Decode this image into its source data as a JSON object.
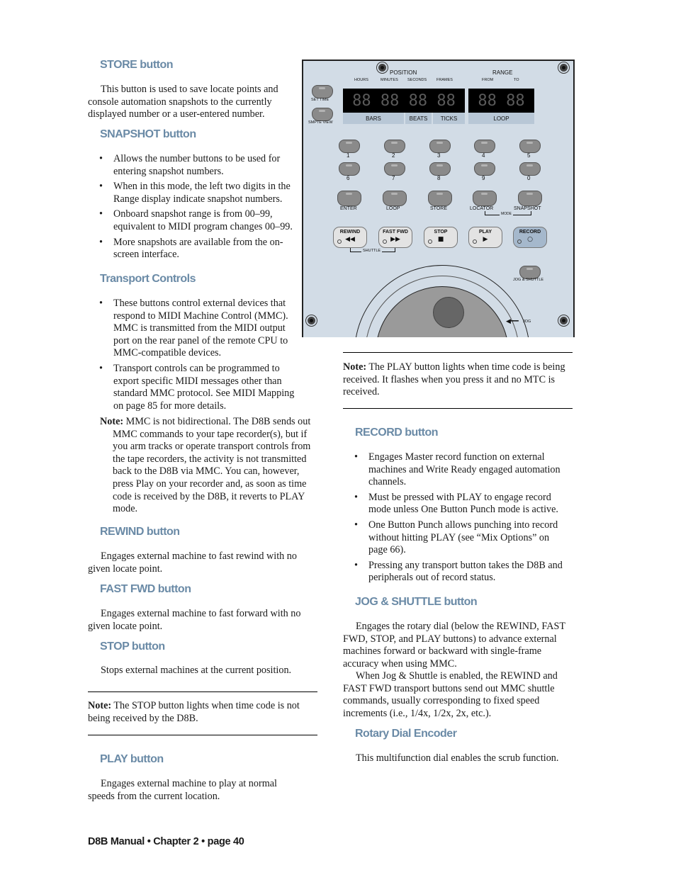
{
  "left_column": {
    "store": {
      "heading": "STORE button",
      "body": "This button is used to save locate points and console automation snapshots to the currently displayed number or a user-entered number."
    },
    "snapshot": {
      "heading": "SNAPSHOT button",
      "bullets": [
        "Allows the number buttons to be used for entering snapshot numbers.",
        "When in this mode, the left two digits in the Range display indicate snapshot numbers.",
        "Onboard snapshot range is from 00–99, equivalent to MIDI program changes 00–99.",
        "More snapshots are available from the on-screen interface."
      ]
    },
    "transport": {
      "heading": "Transport Controls",
      "bullets": [
        "These buttons control external devices that respond to MIDI Machine Control (MMC). MMC is transmitted from the MIDI output port on the rear panel of the remote CPU to MMC-compatible devices.",
        "Transport controls can be programmed to export specific MIDI messages other than standard MMC protocol. See MIDI Mapping on page 85 for more details."
      ],
      "note_label": "Note:",
      "note_text": " MMC is not bidirectional. The D8B sends out MMC commands to your tape recorder(s), but if you arm tracks or operate transport controls from the tape recorders, the activity is not transmitted back to the D8B via MMC. You can, however, press Play on your recorder and, as soon as time code is received by the D8B, it reverts to PLAY mode."
    },
    "rewind": {
      "heading": "REWIND button",
      "body": "Engages external machine to fast rewind with no given locate point."
    },
    "fastfwd": {
      "heading": "FAST FWD button",
      "body": "Engages external machine to fast forward with no given locate point."
    },
    "stop": {
      "heading": "STOP button",
      "body": "Stops external machines at the current position.",
      "note_label": "Note:",
      "note_text": " The STOP button lights when time code is not being received by the D8B."
    },
    "play": {
      "heading": "PLAY button",
      "body": "Engages external machine to play at normal speeds from the current location."
    }
  },
  "right_column": {
    "play_note_label": "Note:",
    "play_note_text": " The PLAY button lights when time code is being received. It flashes when you press it and no MTC is received.",
    "record": {
      "heading": "RECORD button",
      "bullets": [
        "Engages Master record function on external machines and Write Ready engaged automation channels.",
        "Must be pressed with PLAY to engage record mode unless One Button Punch mode is active.",
        "One Button Punch allows punching into record without hitting PLAY (see “Mix Options” on page 66).",
        "Pressing any transport button takes the D8B and peripherals out of record status."
      ]
    },
    "jog": {
      "heading": "JOG & SHUTTLE button",
      "body1": "Engages the rotary dial (below the REWIND, FAST FWD, STOP, and PLAY buttons) to advance external machines forward or backward with single-frame accuracy when using MMC.",
      "body2": "When Jog & Shuttle is enabled, the REWIND and FAST FWD transport buttons send out MMC shuttle commands, usually corresponding to fixed speed increments (i.e., 1/4x, 1/2x, 2x, etc.)."
    },
    "rotary": {
      "heading": "Rotary Dial Encoder",
      "body": "This multifunction dial enables the scrub function."
    }
  },
  "panel": {
    "position_title": "POSITION",
    "position_sublabels": [
      "HOURS",
      "MINUTES",
      "SECONDS",
      "FRAMES"
    ],
    "range_title": "RANGE",
    "range_sublabels": [
      "FROM",
      "TO"
    ],
    "position_digits": "88 88 88 88",
    "range_digits": "88 88",
    "position_bottom": [
      "BARS",
      "BEATS",
      "TICKS"
    ],
    "range_bottom": "LOOP",
    "set_time": "SET TIME",
    "smpte_view": "SMPTE VIEW",
    "numbers_row1": [
      "1",
      "2",
      "3",
      "4",
      "5"
    ],
    "numbers_row2": [
      "6",
      "7",
      "8",
      "9",
      "0"
    ],
    "function_keys": [
      "ENTER",
      "LOOP",
      "STORE",
      "LOCATOR",
      "SNAPSHOT"
    ],
    "mode_label": "MODE",
    "transport": [
      {
        "label": "REWIND",
        "glyph": "◀◀"
      },
      {
        "label": "FAST FWD",
        "glyph": "▶▶"
      },
      {
        "label": "STOP",
        "glyph": "■"
      },
      {
        "label": "PLAY",
        "glyph": "▶"
      },
      {
        "label": "RECORD",
        "glyph": "○"
      }
    ],
    "shuttle_label": "SHUTTLE",
    "jog_shuttle_label": "JOG & SHUTTLE",
    "jog_label": "JOG"
  },
  "footer": "D8B Manual • Chapter 2 • page 40",
  "colors": {
    "heading": "#6a8aa6",
    "panel_bg": "#d2dce6",
    "record_button": "#a5b8cc"
  }
}
